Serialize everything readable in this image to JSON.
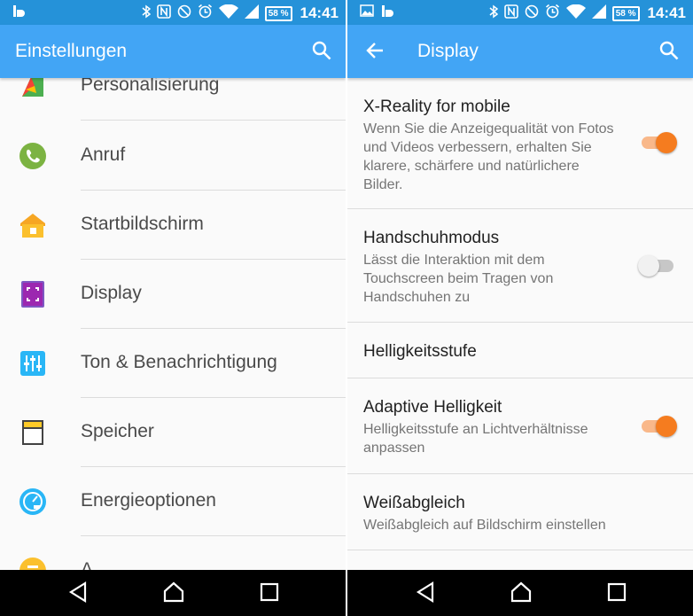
{
  "status": {
    "time": "14:41",
    "battery": "58 %"
  },
  "colors": {
    "statusbar": "#2592d9",
    "appbar": "#42a5f5",
    "toggle_on": "#f57c1f",
    "toggle_off": "#f1f1f1"
  },
  "left": {
    "title": "Einstellungen",
    "items": [
      {
        "label": "Personalisierung",
        "icon": "palette-icon"
      },
      {
        "label": "Anruf",
        "icon": "phone-icon"
      },
      {
        "label": "Startbildschirm",
        "icon": "home-icon"
      },
      {
        "label": "Display",
        "icon": "display-icon"
      },
      {
        "label": "Ton & Benachrichtigung",
        "icon": "sliders-icon"
      },
      {
        "label": "Speicher",
        "icon": "sd-card-icon"
      },
      {
        "label": "Energieoptionen",
        "icon": "battery-gauge-icon"
      },
      {
        "label": "A...",
        "icon": "partial-icon"
      }
    ]
  },
  "right": {
    "title": "Display",
    "settings": [
      {
        "title": "X-Reality for mobile",
        "summary": "Wenn Sie die Anzeigequalität von Fotos und Videos verbessern, erhalten Sie klarere, schärfere und natürlichere Bilder.",
        "toggle": true
      },
      {
        "title": "Handschuhmodus",
        "summary": "Lässt die Interaktion mit dem Touchscreen beim Tragen von Handschuhen zu",
        "toggle": false
      },
      {
        "title": "Helligkeitsstufe"
      },
      {
        "title": "Adaptive Helligkeit",
        "summary": "Helligkeitsstufe an Lichtverhältnisse anpassen",
        "toggle": true
      },
      {
        "title": "Weißabgleich",
        "summary": "Weißabgleich auf Bildschirm einstellen"
      }
    ]
  }
}
